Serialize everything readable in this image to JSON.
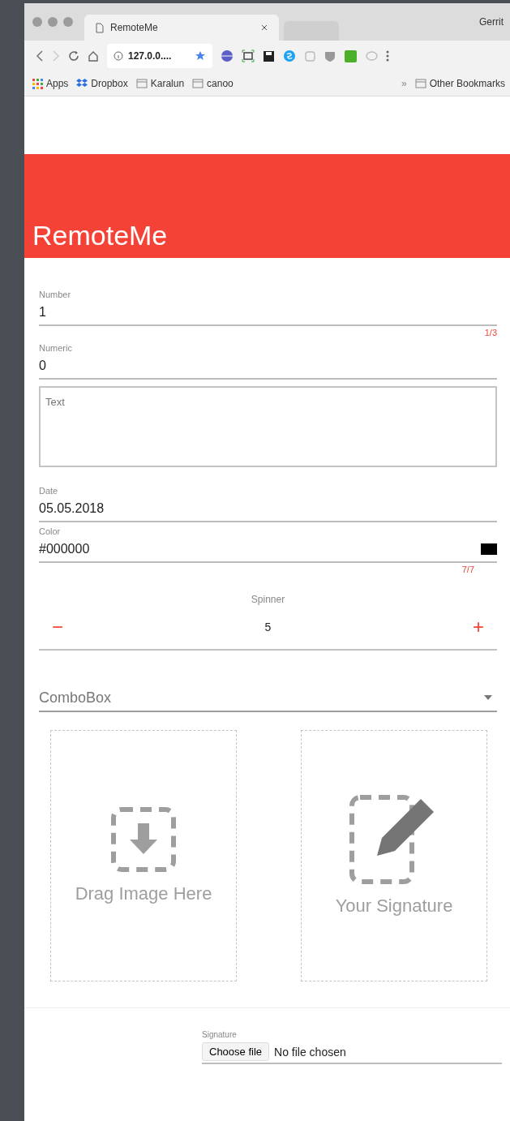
{
  "browser": {
    "user": "Gerrit",
    "tabs": [
      {
        "title": "RemoteMe",
        "selected": true
      },
      {
        "selected": false
      }
    ],
    "address": "127.0.0....",
    "bookmarks": [
      {
        "label": "Apps",
        "kind": "apps"
      },
      {
        "label": "Dropbox",
        "kind": "dropbox"
      },
      {
        "label": "Karalun",
        "kind": "folder"
      },
      {
        "label": "canoo",
        "kind": "folder"
      }
    ],
    "overflow": "»",
    "other_bookmarks": "Other Bookmarks"
  },
  "header": {
    "title": "RemoteMe"
  },
  "fields": [
    {
      "kind": "input",
      "label": "Number",
      "value": "1",
      "counter": "1/3"
    },
    {
      "kind": "input",
      "label": "Numeric",
      "value": "0"
    },
    {
      "kind": "textarea",
      "placeholder": "Text"
    },
    {
      "kind": "input",
      "label": "Date",
      "value": "05.05.2018"
    },
    {
      "kind": "color",
      "label": "Color",
      "value": "#000000",
      "color": "#000000",
      "counter": "7/7"
    },
    {
      "kind": "spinner",
      "label": "Spinner",
      "value": "5",
      "minus": "−",
      "plus": "+"
    },
    {
      "kind": "combo",
      "placeholder": "ComboBox"
    }
  ],
  "drop_zones": [
    {
      "kind": "image",
      "label": "Drag Image Here"
    },
    {
      "kind": "signature",
      "label": "Your Signature"
    }
  ],
  "file": {
    "label": "Signature",
    "button": "Choose file",
    "status": "No file chosen"
  }
}
